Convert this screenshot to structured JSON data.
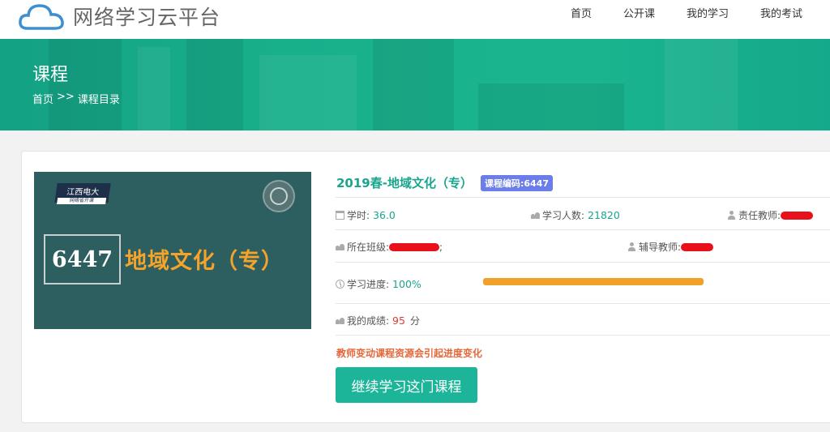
{
  "header": {
    "logo_text": "网络学习云平台",
    "logo_icon": "cloud-icon",
    "nav": [
      "首页",
      "公开课",
      "我的学习",
      "我的考试"
    ]
  },
  "banner": {
    "title": "课程",
    "breadcrumb": [
      "首页",
      ">>",
      "课程目录"
    ]
  },
  "course": {
    "thumbnail": {
      "tag_top": "江西电大",
      "tag_sub": "网络省开课",
      "code": "6447",
      "name": "地域文化（专）"
    },
    "title": "2019春-地域文化（专）",
    "code_badge": "课程编码:6447",
    "hours_label": "学时:",
    "hours": "36.0",
    "learners_label": "学习人数:",
    "learners": "21820",
    "teacher_label": "责任教师:",
    "class_label": "所在班级:",
    "class_suffix": ";",
    "tutor_label": "辅导教师:",
    "progress_label": "学习进度:",
    "progress_text": "100%",
    "progress_value": 100,
    "score_label": "我的成绩:",
    "score": "95",
    "score_unit": "分",
    "notice": "教师变动课程资源会引起进度变化",
    "continue_button": "继续学习这门课程"
  },
  "colors": {
    "accent": "#1aa58e",
    "banner": "#18b08b",
    "progress": "#f0a12a",
    "badge": "#6b7de8",
    "score": "#e03a3a",
    "notice": "#e4683a"
  }
}
